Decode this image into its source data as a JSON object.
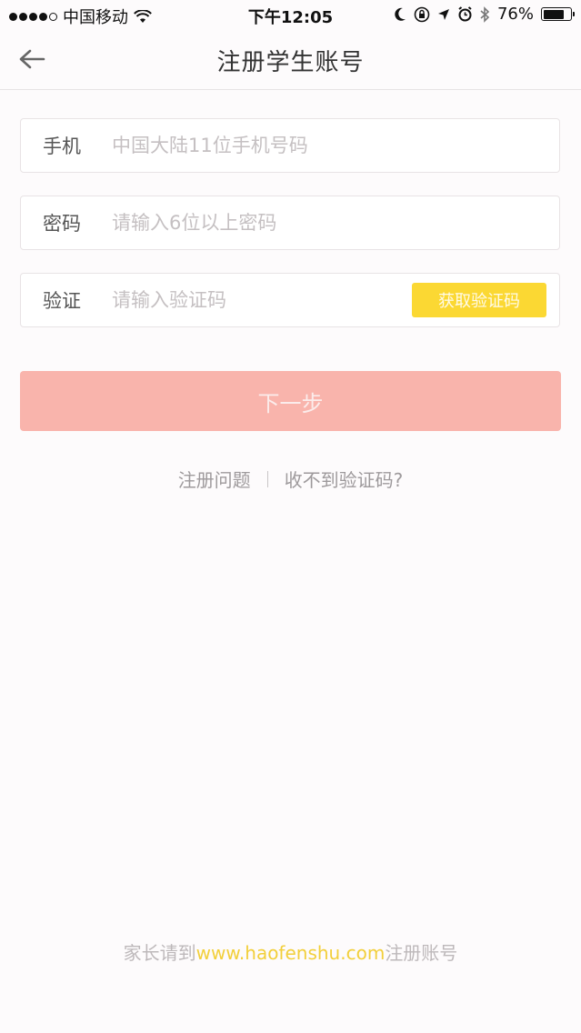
{
  "status_bar": {
    "carrier": "中国移动",
    "time": "下午12:05",
    "battery": "76%",
    "battery_level": 76,
    "icons": [
      "signal-dots",
      "wifi-icon",
      "moon-icon",
      "rotation-lock-icon",
      "location-icon",
      "alarm-icon",
      "bluetooth-icon",
      "battery-icon"
    ]
  },
  "nav": {
    "back_icon": "arrow-left-icon",
    "title": "注册学生账号"
  },
  "form": {
    "phone": {
      "label": "手机",
      "value": "",
      "placeholder": "中国大陆11位手机号码"
    },
    "password": {
      "label": "密码",
      "value": "",
      "placeholder": "请输入6位以上密码"
    },
    "code": {
      "label": "验证",
      "value": "",
      "placeholder": "请输入验证码",
      "button_label": "获取验证码"
    },
    "next_label": "下一步"
  },
  "help": {
    "register_problem": "注册问题",
    "no_code": "收不到验证码?"
  },
  "footer": {
    "prefix": "家长请到",
    "link": "www.haofenshu.com",
    "suffix": "注册账号"
  },
  "colors": {
    "accent_yellow": "#fbd833",
    "next_button": "#f9b4ac",
    "link_yellow": "#f2cf3a"
  }
}
